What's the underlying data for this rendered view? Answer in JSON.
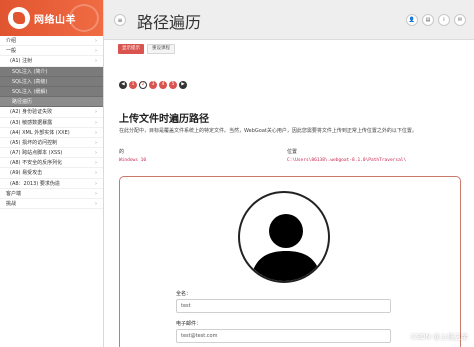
{
  "brand": {
    "name": "网络山羊"
  },
  "sidebar": {
    "items": [
      {
        "label": "介绍",
        "chev": "›",
        "type": "top"
      },
      {
        "label": "一般",
        "chev": "›",
        "type": "top"
      },
      {
        "label": "(A1) 注射",
        "chev": "›",
        "type": "sub"
      },
      {
        "label": "SQL注入 (简介)",
        "chev": "",
        "type": "active"
      },
      {
        "label": "SQL注入 (高级)",
        "chev": "",
        "type": "active"
      },
      {
        "label": "SQL注入 (缓解)",
        "chev": "",
        "type": "active"
      },
      {
        "label": "路径遍历",
        "chev": "",
        "type": "active-current"
      },
      {
        "label": "(A2) 身份验证失败",
        "chev": "›",
        "type": "sub"
      },
      {
        "label": "(A3) 敏感数据暴露",
        "chev": "›",
        "type": "sub"
      },
      {
        "label": "(A4) XML 外部实体 (XXE)",
        "chev": "›",
        "type": "sub"
      },
      {
        "label": "(A5) 损坏的访问控制",
        "chev": "›",
        "type": "sub"
      },
      {
        "label": "(A7) 跨站点脚本 (XSS)",
        "chev": "›",
        "type": "sub"
      },
      {
        "label": "(A8) 不安全的反序列化",
        "chev": "›",
        "type": "sub"
      },
      {
        "label": "(A9) 易受攻击",
        "chev": "›",
        "type": "sub"
      },
      {
        "label": "(A8：2013) 要求伪造",
        "chev": "›",
        "type": "sub"
      },
      {
        "label": "客户端",
        "chev": "›",
        "type": "top"
      },
      {
        "label": "挑战",
        "chev": "›",
        "type": "top"
      }
    ]
  },
  "header": {
    "menu_icon": "≡",
    "title": "路径遍历",
    "icons": [
      {
        "name": "user-icon",
        "glyph": "👤"
      },
      {
        "name": "report-icon",
        "glyph": "▤"
      },
      {
        "name": "info-icon",
        "glyph": "i"
      },
      {
        "name": "mail-icon",
        "glyph": "✉"
      }
    ]
  },
  "toolbar": {
    "show_hints": "显示提示",
    "reset_lesson": "重设课程"
  },
  "pager": {
    "prev": "◀",
    "pages": [
      "1",
      "2",
      "3",
      "4",
      "5"
    ],
    "active_page": "2",
    "next": "▶"
  },
  "lesson": {
    "title": "上传文件时遍历路径",
    "description": "在此分配中，目标是覆盖文件系统上的特定文件。当然，WebGoat关心用户，因此您需要将文件上传到正常上传位置之外的以下位置。"
  },
  "info": {
    "os_label": "的",
    "location_label": "位置",
    "os_value": "Windows 10",
    "location_value": "C:\\Users\\86138\\.webgoat-8.1.0\\PathTraversal\\"
  },
  "form": {
    "fullname_label": "全名：",
    "fullname_value": "test",
    "email_label": "电子邮件：",
    "email_value": "test@test.com"
  },
  "watermark": "CSDN @上线之余"
}
